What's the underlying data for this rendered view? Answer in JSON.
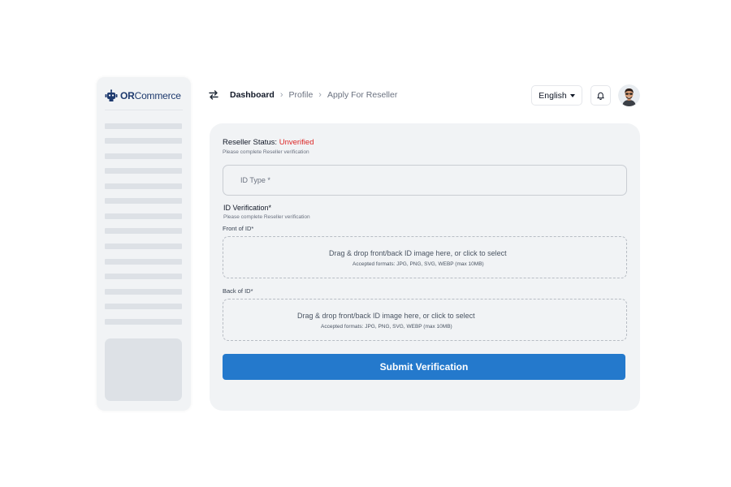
{
  "brand": {
    "bold": "OR",
    "rest": "Commerce",
    "accent": "#1e3a6e"
  },
  "breadcrumb": {
    "items": [
      "Dashboard",
      "Profile",
      "Apply For Reseller"
    ]
  },
  "header": {
    "language": "English"
  },
  "reseller": {
    "status_label": "Reseller Status:",
    "status_value": "Unverified",
    "status_color": "#dc2626",
    "status_note": "Please complete Reseller verification"
  },
  "form": {
    "id_type_placeholder": "ID Type *",
    "id_verification_title": "ID Verification*",
    "id_verification_note": "Please complete Reseller verification",
    "front_label": "Front of ID*",
    "back_label": "Back of ID*",
    "dropzone_text": "Drag & drop front/back ID image here, or click to select",
    "dropzone_formats": "Accepted formats: JPG, PNG, SVG, WEBP (max 10MB)",
    "submit_label": "Submit Verification",
    "submit_color": "#2479cc"
  },
  "icons": [
    "robot-logo-icon",
    "swap-arrows-icon",
    "chevron-right-icon",
    "caret-down-icon",
    "bell-icon"
  ]
}
